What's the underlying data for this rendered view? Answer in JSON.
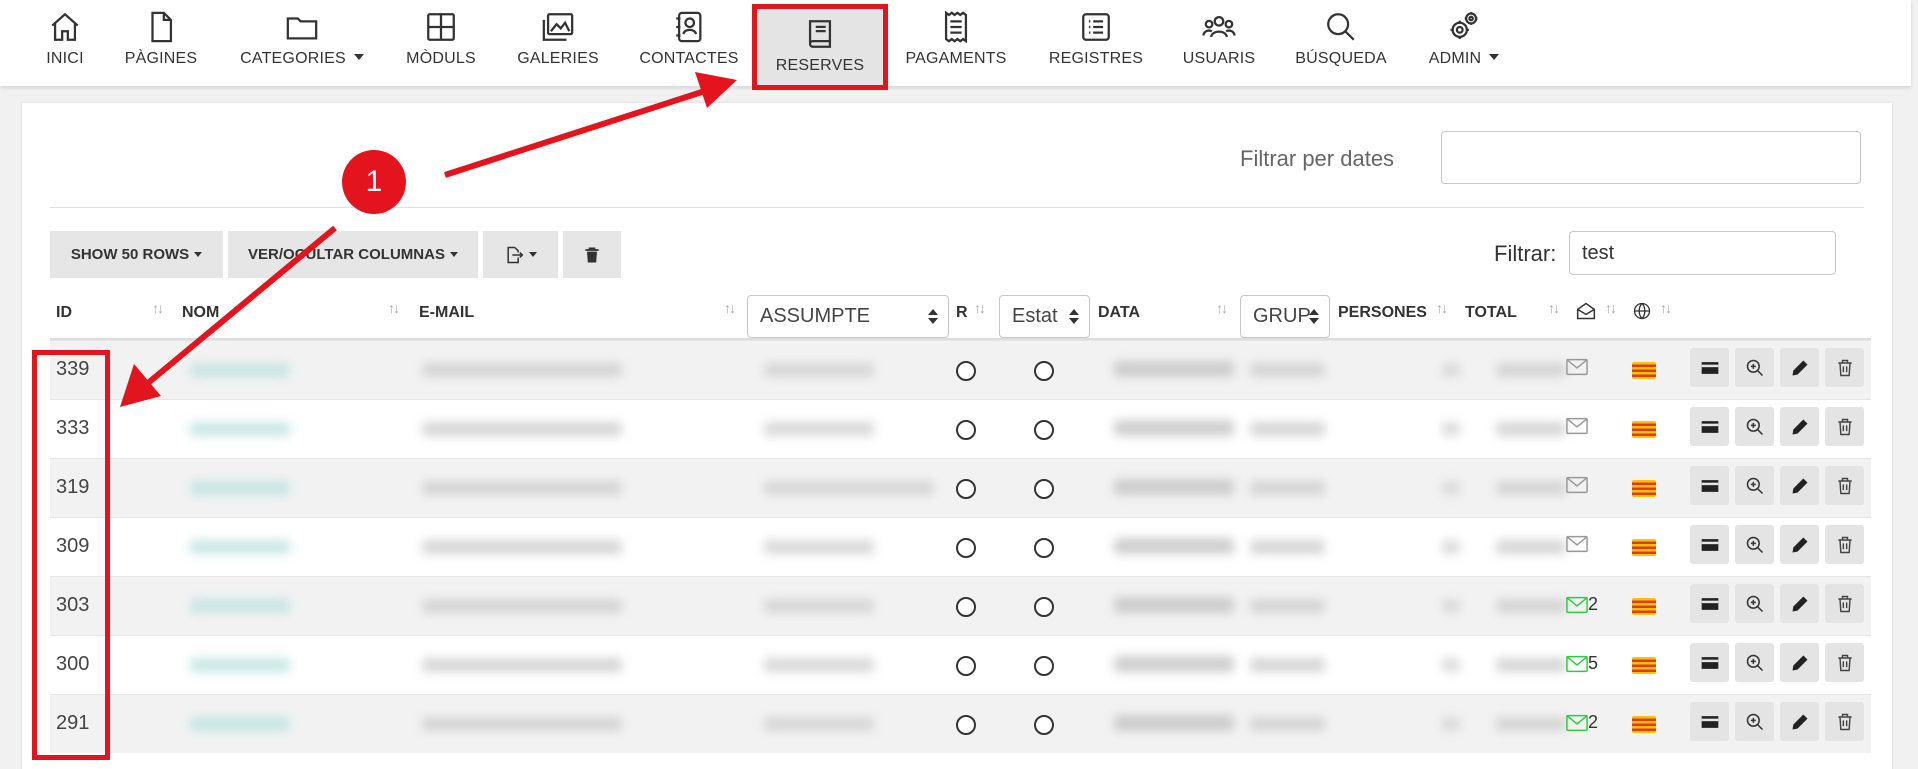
{
  "nav": {
    "items": [
      {
        "label": "INICI",
        "icon": "home-icon"
      },
      {
        "label": "PÀGINES",
        "icon": "file-icon"
      },
      {
        "label": "CATEGORIES",
        "icon": "folder-icon",
        "dropdown": true
      },
      {
        "label": "MÒDULS",
        "icon": "grid-icon"
      },
      {
        "label": "GALERIES",
        "icon": "images-icon"
      },
      {
        "label": "CONTACTES",
        "icon": "contact-book-icon"
      },
      {
        "label": "RESERVES",
        "icon": "book-icon",
        "active": true
      },
      {
        "label": "PAGAMENTS",
        "icon": "receipt-icon"
      },
      {
        "label": "REGISTRES",
        "icon": "list-icon"
      },
      {
        "label": "USUARIS",
        "icon": "users-icon"
      },
      {
        "label": "BÚSQUEDA",
        "icon": "search-icon"
      },
      {
        "label": "ADMIN",
        "icon": "gears-icon",
        "dropdown": true
      }
    ]
  },
  "filter_dates": {
    "label": "Filtrar per dates",
    "value": ""
  },
  "toolbar": {
    "show_rows": "SHOW 50 ROWS",
    "columns": "VER/OCULTAR COLUMNAS",
    "export_icon": "export-icon",
    "delete_icon": "trash-icon"
  },
  "search": {
    "label": "Filtrar:",
    "value": "test"
  },
  "table": {
    "headers": {
      "id": "ID",
      "nom": "NOM",
      "email": "E-MAIL",
      "assumpte": "ASSUMPTE",
      "r": "R",
      "estat": "Estat",
      "data": "DATA",
      "grup": "GRUP",
      "persones": "PERSONES",
      "total": "TOTAL"
    },
    "rows": [
      {
        "id": "339",
        "mails": ""
      },
      {
        "id": "333",
        "mails": ""
      },
      {
        "id": "319",
        "mails": ""
      },
      {
        "id": "309",
        "mails": ""
      },
      {
        "id": "303",
        "mails": "2"
      },
      {
        "id": "300",
        "mails": "5"
      },
      {
        "id": "291",
        "mails": "2"
      }
    ]
  },
  "annotation": {
    "step_number": "1"
  },
  "colors": {
    "accent_red": "#e3141d",
    "mail_green": "#2ecc40",
    "mail_gray": "#999999"
  }
}
